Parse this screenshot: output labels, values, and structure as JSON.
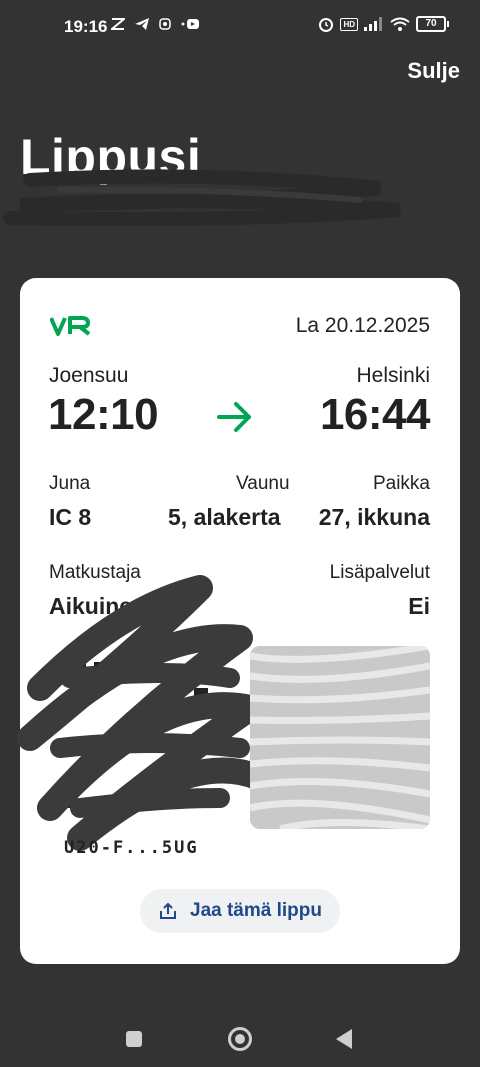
{
  "status_bar": {
    "time": "19:16",
    "battery": "70"
  },
  "header": {
    "close_label": "Sulje",
    "title": "Lippusi",
    "subtitle": "...numero ..."
  },
  "ticket": {
    "date": "La 20.12.2025",
    "from_city": "Joensuu",
    "to_city": "Helsinki",
    "departure_time": "12:10",
    "arrival_time": "16:44",
    "train_label": "Juna",
    "train_value": "IC 8",
    "car_label": "Vaunu",
    "car_value": "5, alakerta",
    "seat_label": "Paikka",
    "seat_value": "27, ikkuna",
    "passenger_label": "Matkustaja",
    "passenger_value": "Aikuinen",
    "extras_label": "Lisäpalvelut",
    "extras_value": "Ei",
    "barcode_code": "U20-F...5UG",
    "share_label": "Jaa tämä lippu"
  },
  "colors": {
    "background": "#333333",
    "card": "#ffffff",
    "accent_green": "#00a651",
    "share_text": "#1f4a8a"
  },
  "icons": {
    "logo": "vr-logo",
    "arrow": "arrow-right-icon",
    "share": "share-upload-icon"
  }
}
